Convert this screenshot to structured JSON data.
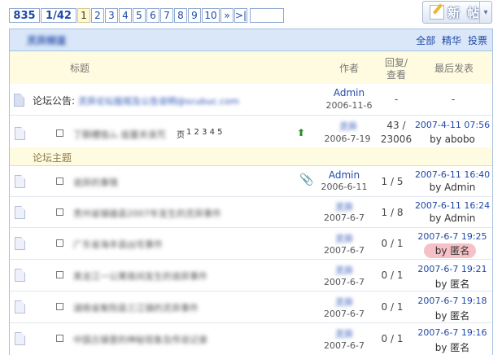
{
  "pager": {
    "total": "835",
    "pages": "1/42",
    "numbers": [
      "1",
      "2",
      "3",
      "4",
      "5",
      "6",
      "7",
      "8",
      "9",
      "10"
    ],
    "next": "»",
    "last": ">|",
    "input_value": ""
  },
  "new_post": {
    "label": "新 帖",
    "arrow": "▾"
  },
  "header": {
    "forum_name": "灵异频道",
    "all": "全部",
    "digest": "精华",
    "vote": "投票"
  },
  "columns": {
    "title": "标题",
    "author": "作者",
    "reply": "回复/",
    "view": "查看",
    "last": "最后发表"
  },
  "announcement": {
    "label": "论坛公告:",
    "text": "灵异论坛版规及公告说明@scubuc.com",
    "author": "Admin",
    "date": "2006-11-6",
    "count": "-",
    "last": "-"
  },
  "pinned": {
    "title": "丁酮槽恤ム 疽量关诛咒",
    "pages_icon": "页",
    "pages": "1 2 3 4 5",
    "author": "灵异",
    "date": "2006-7-19",
    "replies": "43 /",
    "views": "23006",
    "last_time": "2007-4-11 07:56",
    "last_by": "by abobo"
  },
  "section": {
    "label": "论坛主题"
  },
  "threads": [
    {
      "title": "诡异的事情",
      "author": "Admin",
      "date": "2006-6-11",
      "counts": "1 / 5",
      "last_time": "2007-6-11 16:40",
      "last_by": "by Admin"
    },
    {
      "title": "贵州省镇雄县2007年发生的灵异事件",
      "author": "灵异",
      "date": "2007-6-7",
      "counts": "1 / 8",
      "last_time": "2007-6-11 16:24",
      "last_by": "by Admin"
    },
    {
      "title": "广东省海丰县凶宅事件",
      "author": "灵异",
      "date": "2007-6-7",
      "counts": "0 / 1",
      "last_time": "2007-6-7 19:25",
      "last_by": "by 匿名"
    },
    {
      "title": "黑龙江一公寓夜间发生的诡异事件",
      "author": "灵异",
      "date": "2007-6-7",
      "counts": "0 / 1",
      "last_time": "2007-6-7 19:21",
      "last_by": "by 匿名"
    },
    {
      "title": "湖南省衡阳县三江镇的灵异事件",
      "author": "灵异",
      "date": "2007-6-7",
      "counts": "0 / 1",
      "last_time": "2007-6-7 19:18",
      "last_by": "by 匿名"
    },
    {
      "title": "中国古镇里的神秘现象及传说记录",
      "author": "灵异",
      "date": "2007-6-7",
      "counts": "0 / 1",
      "last_time": "2007-6-7 19:16",
      "last_by": "by 匿名"
    }
  ]
}
